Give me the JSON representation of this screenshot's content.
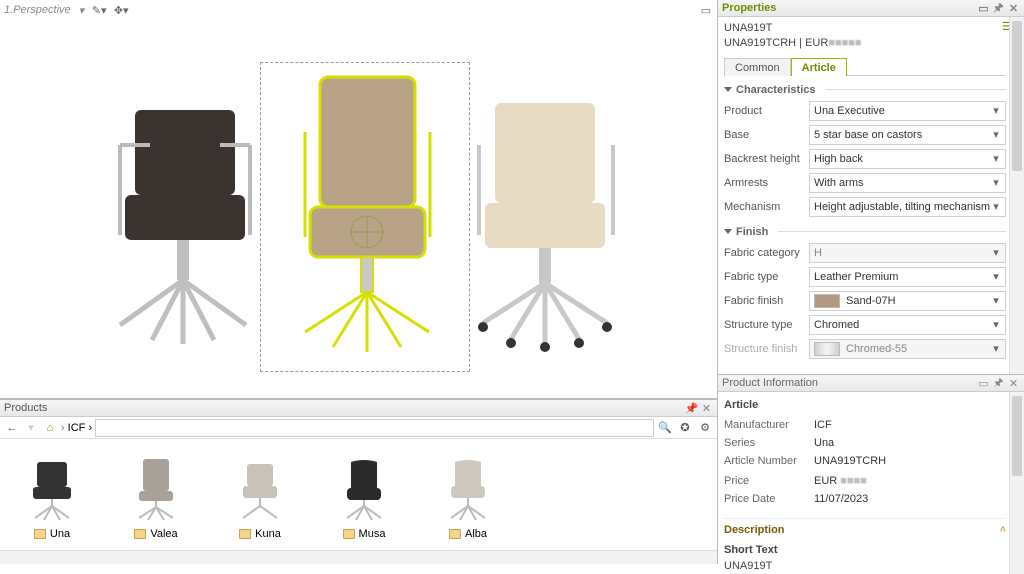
{
  "viewport": {
    "label": "1.Perspective"
  },
  "products": {
    "title": "Products",
    "crumb": "ICF  ›",
    "items": [
      {
        "label": "Una"
      },
      {
        "label": "Valea"
      },
      {
        "label": "Kuna"
      },
      {
        "label": "Musa"
      },
      {
        "label": "Alba"
      }
    ]
  },
  "properties": {
    "title": "Properties",
    "obj_code": "UNA919T",
    "obj_line2_a": "UNA919TCRH | EUR",
    "obj_line2_blur": "■■■■■",
    "tabs": {
      "common": "Common",
      "article": "Article"
    },
    "sections": {
      "characteristics": "Characteristics",
      "finish": "Finish"
    },
    "fields": {
      "product": {
        "label": "Product",
        "value": "Una Executive"
      },
      "base": {
        "label": "Base",
        "value": "5 star base on castors"
      },
      "backrest": {
        "label": "Backrest height",
        "value": "High back"
      },
      "armrests": {
        "label": "Armrests",
        "value": "With arms"
      },
      "mechanism": {
        "label": "Mechanism",
        "value": "Height adjustable, tilting mechanism"
      },
      "fabric_cat": {
        "label": "Fabric category",
        "value": "H"
      },
      "fabric_type": {
        "label": "Fabric type",
        "value": "Leather Premium"
      },
      "fabric_finish": {
        "label": "Fabric finish",
        "value": "Sand-07H",
        "swatch": "#b09b81"
      },
      "structure_type": {
        "label": "Structure type",
        "value": "Chromed"
      },
      "structure_fin": {
        "label": "Structure finish",
        "value": "Chromed-55",
        "swatch": "linear-gradient(90deg,#cfcfcf,#f5f5f5,#cfcfcf)"
      }
    }
  },
  "info": {
    "title": "Product Information",
    "article_head": "Article",
    "rows": {
      "manufacturer": {
        "label": "Manufacturer",
        "value": "ICF"
      },
      "series": {
        "label": "Series",
        "value": "Una"
      },
      "article_no": {
        "label": "Article Number",
        "value": "UNA919TCRH"
      },
      "price": {
        "label": "Price",
        "value": "EUR",
        "blur": "■■■■"
      },
      "price_date": {
        "label": "Price Date",
        "value": "11/07/2023"
      }
    },
    "description_head": "Description",
    "short_text_label": "Short Text",
    "short_text_value": "UNA919T"
  }
}
